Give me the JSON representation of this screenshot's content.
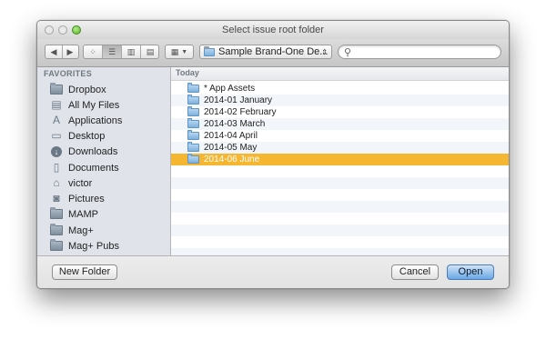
{
  "window": {
    "title": "Select issue root folder"
  },
  "toolbar": {
    "path_label": "Sample Brand-One De...",
    "search_placeholder": ""
  },
  "sidebar": {
    "section_label": "FAVORITES",
    "items": [
      {
        "label": "Dropbox",
        "icon": "folder-icon"
      },
      {
        "label": "All My Files",
        "icon": "all-files-icon"
      },
      {
        "label": "Applications",
        "icon": "applications-icon"
      },
      {
        "label": "Desktop",
        "icon": "desktop-icon"
      },
      {
        "label": "Downloads",
        "icon": "downloads-icon"
      },
      {
        "label": "Documents",
        "icon": "documents-icon"
      },
      {
        "label": "victor",
        "icon": "home-icon"
      },
      {
        "label": "Pictures",
        "icon": "pictures-icon"
      },
      {
        "label": "MAMP",
        "icon": "folder-icon"
      },
      {
        "label": "Mag+",
        "icon": "folder-icon"
      },
      {
        "label": "Mag+ Pubs",
        "icon": "folder-icon"
      }
    ]
  },
  "file_list": {
    "group_label": "Today",
    "items": [
      {
        "name": "* App Assets",
        "selected": false
      },
      {
        "name": "2014-01 January",
        "selected": false
      },
      {
        "name": "2014-02 February",
        "selected": false
      },
      {
        "name": "2014-03 March",
        "selected": false
      },
      {
        "name": "2014-04 April",
        "selected": false
      },
      {
        "name": "2014-05 May",
        "selected": false
      },
      {
        "name": "2014-06 June",
        "selected": true
      }
    ]
  },
  "buttons": {
    "new_folder": "New Folder",
    "cancel": "Cancel",
    "open": "Open"
  },
  "colors": {
    "selection": "#f5b731",
    "default_button": "#6aa7e6"
  }
}
